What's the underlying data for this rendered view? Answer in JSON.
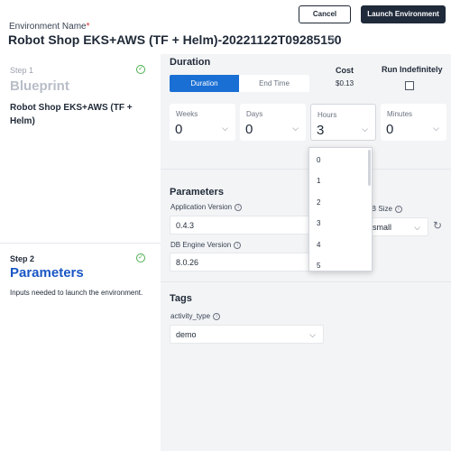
{
  "header": {
    "env_label": "Environment Name",
    "required_mark": "*",
    "env_name": "Robot Shop EKS+AWS (TF + Helm)-20221122T09285150",
    "cancel_label": "Cancel",
    "launch_label": "Launch Environment"
  },
  "steps": [
    {
      "label": "Step 1",
      "title": "Blueprint",
      "description": "Robot Shop EKS+AWS (TF + Helm)",
      "completed": true
    },
    {
      "label": "Step 2",
      "title": "Parameters",
      "description": "Inputs needed to launch the environment.",
      "completed": true
    }
  ],
  "duration": {
    "title": "Duration",
    "mode_selected": "Duration",
    "mode_options": [
      "Duration",
      "End Time"
    ],
    "cost_label": "Cost",
    "cost_value": "$0.13",
    "run_indef_label": "Run Indefinitely",
    "run_indefinitely": false,
    "fields": [
      {
        "label": "Weeks",
        "value": "0"
      },
      {
        "label": "Days",
        "value": "0"
      },
      {
        "label": "Hours",
        "value": "3"
      },
      {
        "label": "Minutes",
        "value": "0"
      }
    ],
    "hours_dropdown_options": [
      "0",
      "1",
      "2",
      "3",
      "4",
      "5"
    ]
  },
  "parameters": {
    "title": "Parameters",
    "app_version_label": "Application Version",
    "app_version_value": "0.4.3",
    "db_size_label": "DB Size",
    "db_size_value": "small",
    "db_engine_label": "DB Engine Version",
    "db_engine_value": "8.0.26"
  },
  "tags": {
    "title": "Tags",
    "activity_label": "activity_type",
    "activity_value": "demo"
  },
  "colors": {
    "accent": "#1a6fd4",
    "step_active": "#1a56c4",
    "launch_bg": "#1f2a3a",
    "check": "#4caf50"
  }
}
